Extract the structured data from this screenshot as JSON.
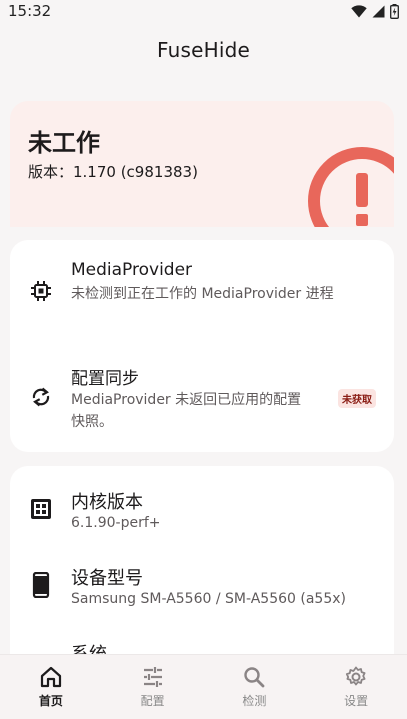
{
  "status_bar": {
    "time": "15:32",
    "icons": [
      "wifi-icon",
      "signal-icon",
      "battery-icon"
    ]
  },
  "app_title": "FuseHide",
  "hero": {
    "title": "未工作",
    "version": "版本：1.170 (c981383)",
    "accent_color": "#e8675b",
    "background_color": "#fcefed"
  },
  "card1": {
    "media_provider": {
      "title": "MediaProvider",
      "subtitle": "未检测到正在工作的 MediaProvider 进程",
      "icon": "chip-icon"
    },
    "config_sync": {
      "title": "配置同步",
      "subtitle_line1": "MediaProvider 未返回已应用的配置",
      "subtitle_line2": "快照。",
      "badge": "未获取",
      "icon": "sync-icon"
    }
  },
  "card2": {
    "kernel": {
      "title": "内核版本",
      "value": "6.1.90-perf+",
      "icon": "cpu-icon"
    },
    "device": {
      "title": "设备型号",
      "value": "Samsung SM-A5560 / SM-A5560 (a55x)",
      "icon": "phone-icon"
    },
    "system": {
      "title": "系统"
    }
  },
  "nav": [
    {
      "label": "首页",
      "icon": "home-icon",
      "active": true
    },
    {
      "label": "配置",
      "icon": "sliders-icon",
      "active": false
    },
    {
      "label": "检测",
      "icon": "search-icon",
      "active": false
    },
    {
      "label": "设置",
      "icon": "gear-icon",
      "active": false
    }
  ]
}
